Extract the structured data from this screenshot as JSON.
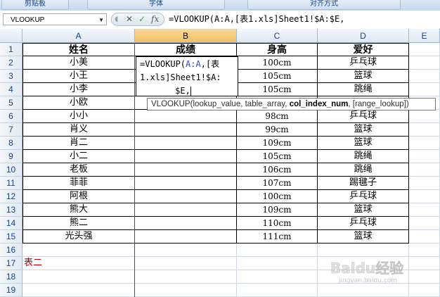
{
  "ribbon": {
    "groups": [
      "剪贴板",
      "字体",
      "对齐方式"
    ]
  },
  "formula_bar": {
    "name_box": "VLOOKUP",
    "cancel_symbol": "✕",
    "enter_symbol": "✓",
    "fx_label": "fx",
    "formula": "=VLOOKUP(A:A,[表1.xls]Sheet1!$A:$E,"
  },
  "columns": [
    "A",
    "B",
    "C",
    "D",
    "E"
  ],
  "rows": [
    "1",
    "2",
    "3",
    "4",
    "5",
    "6",
    "7",
    "8",
    "9",
    "10",
    "11",
    "12",
    "13",
    "14",
    "15",
    "16",
    "17",
    "18",
    "19"
  ],
  "table": {
    "headers": [
      "姓名",
      "成绩",
      "身高",
      "爱好"
    ],
    "names": [
      "小美",
      "小王",
      "小李",
      "小欧",
      "小小",
      "肖义",
      "肖二",
      "小二",
      "老板",
      "菲菲",
      "阿根",
      "熊大",
      "熊二",
      "光头强"
    ],
    "heights": [
      "100cm",
      "105cm",
      "105cm",
      "",
      "98cm",
      "99cm",
      "109cm",
      "105cm",
      "106cm",
      "107cm",
      "100cm",
      "109cm",
      "110cm",
      "111cm"
    ],
    "hobbies": [
      "乒乓球",
      "篮球",
      "跳绳",
      "",
      "乒乓球",
      "篮球",
      "篮球",
      "跳绳",
      "跳绳",
      "踢毽子",
      "乒乓球",
      "篮球",
      "乒乓球",
      "篮球"
    ]
  },
  "sheet_label": "表二",
  "editor": {
    "line1_prefix": "=VLOOKUP(",
    "line1_ref": "A:A",
    "line1_suffix": ",[表",
    "line2": "1.xls]Sheet1!$A:",
    "line3": "$E,"
  },
  "tooltip": {
    "func": "VLOOKUP(",
    "arg1": "lookup_value, table_array, ",
    "arg_current": "col_index_num",
    "arg_rest": ", [range_lookup])"
  },
  "watermark": {
    "text": "Baidu经验",
    "sub": "jingyan.baidu.com"
  },
  "colors": {
    "accent_blue": "#2b49c9",
    "sheet_label_red": "#c00000",
    "ref_highlight": "#2b49c9"
  }
}
